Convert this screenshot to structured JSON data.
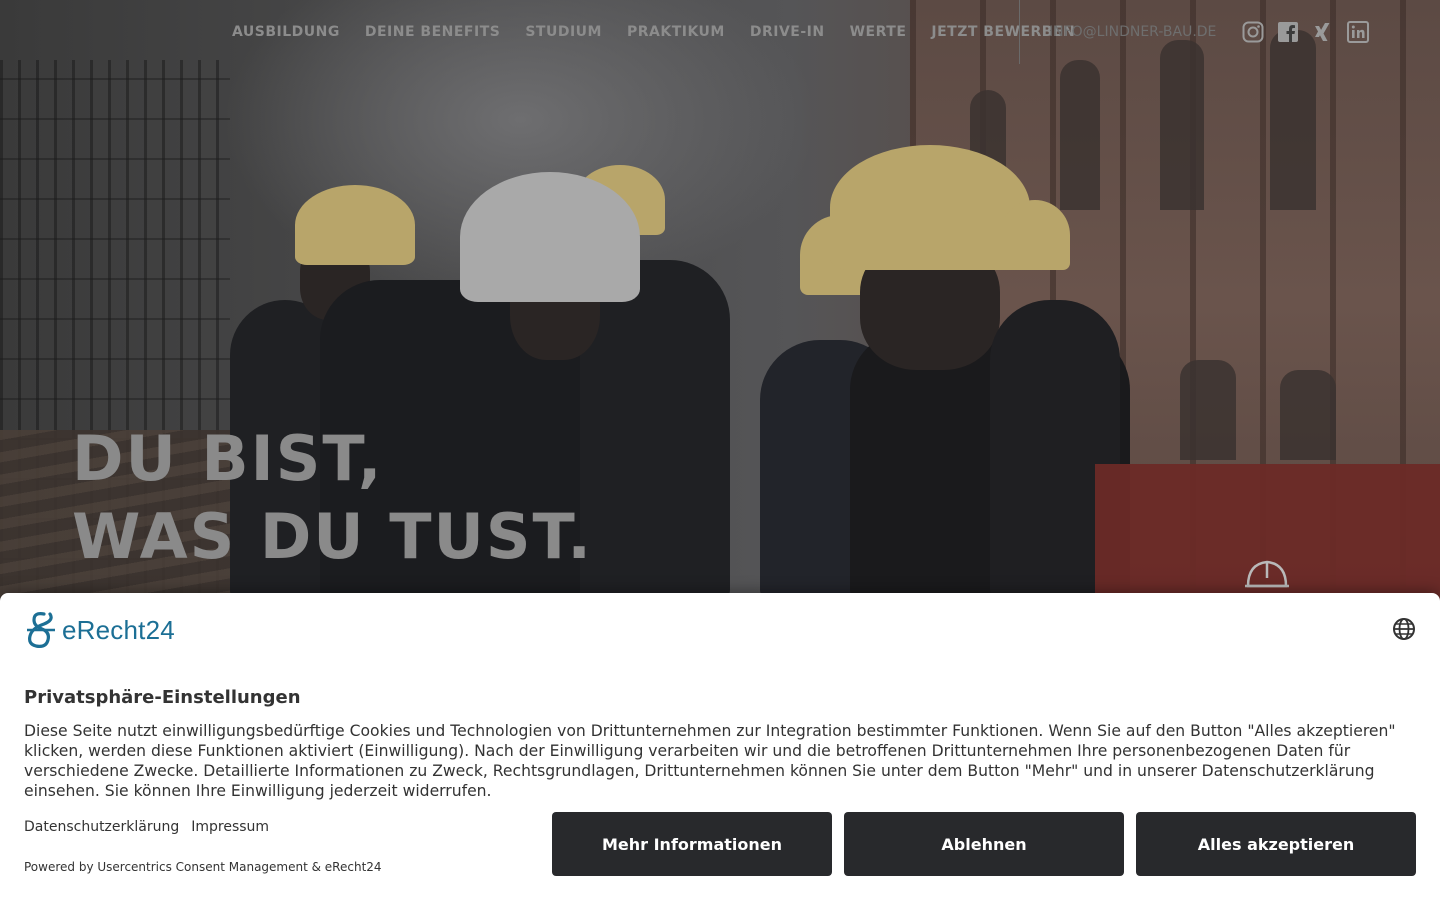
{
  "nav": {
    "links": [
      "AUSBILDUNG",
      "DEINE BENEFITS",
      "STUDIUM",
      "PRAKTIKUM",
      "DRIVE-IN",
      "WERTE",
      "JETZT BEWERBEN"
    ],
    "email": "INFO@LINDNER-BAU.DE",
    "social_icons": [
      "instagram-icon",
      "facebook-icon",
      "xing-icon",
      "linkedin-icon"
    ]
  },
  "hero": {
    "headline_line1": "DU BIST,",
    "headline_line2": "WAS DU TUST.",
    "icon": "helmet-icon"
  },
  "consent": {
    "brand": "eRecht24",
    "title": "Privatsphäre-Einstellungen",
    "description": "Diese Seite nutzt einwilligungsbedürftige Cookies und Technologien von Drittunternehmen zur Integration bestimmter Funktionen. Wenn Sie auf den Button \"Alles akzeptieren\" klicken, werden diese Funktionen aktiviert (Einwilligung). Nach der Einwilligung verarbeiten wir und die betroffenen Drittunternehmen Ihre personenbezogenen Daten für verschiedene Zwecke. Detaillierte Informationen zu Zweck, Rechtsgrundlagen, Drittunternehmen können Sie unter dem Button \"Mehr\" und in unserer Datenschutzerklärung einsehen. Sie können Ihre Einwilligung jederzeit widerrufen.",
    "link_privacy": "Datenschutzerklärung",
    "link_imprint": "Impressum",
    "powered_by": "Powered by Usercentrics Consent Management & eRecht24",
    "btn_more": "Mehr Informationen",
    "btn_decline": "Ablehnen",
    "btn_accept": "Alles akzeptieren",
    "language_icon": "globe-icon"
  },
  "colors": {
    "button_bg": "#28292c",
    "brand_blue": "#1c6f95",
    "hero_red": "#6b2a27"
  }
}
